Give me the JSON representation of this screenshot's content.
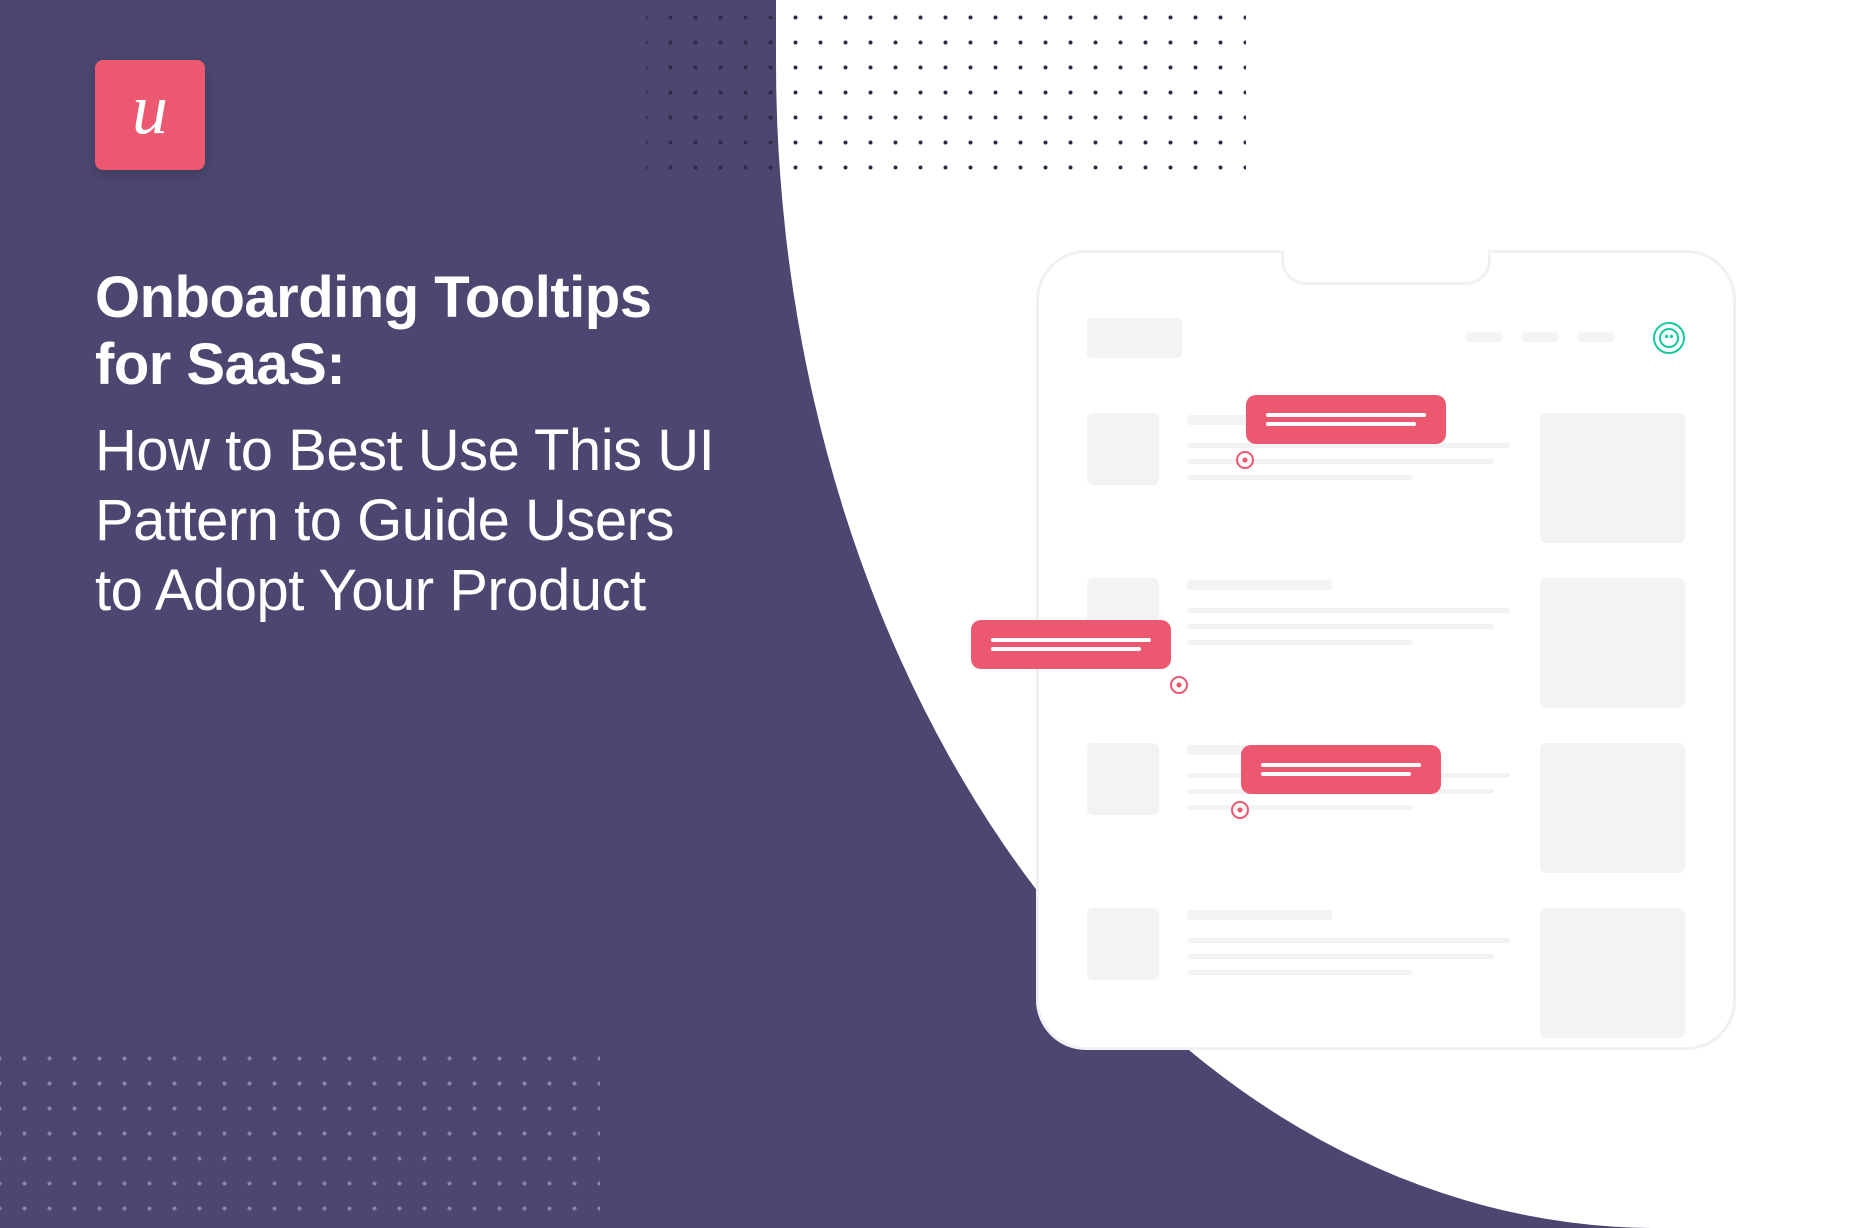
{
  "brand": {
    "logo_letter": "u"
  },
  "headline": {
    "top": "Onboarding Tooltips for SaaS:",
    "bottom": "How to Best Use This UI Pattern to Guide Users to Adopt Your Product"
  },
  "colors": {
    "purple": "#4b4770",
    "accent": "#ed5871",
    "green": "#18c99d",
    "skeleton": "#f3f3f5"
  }
}
